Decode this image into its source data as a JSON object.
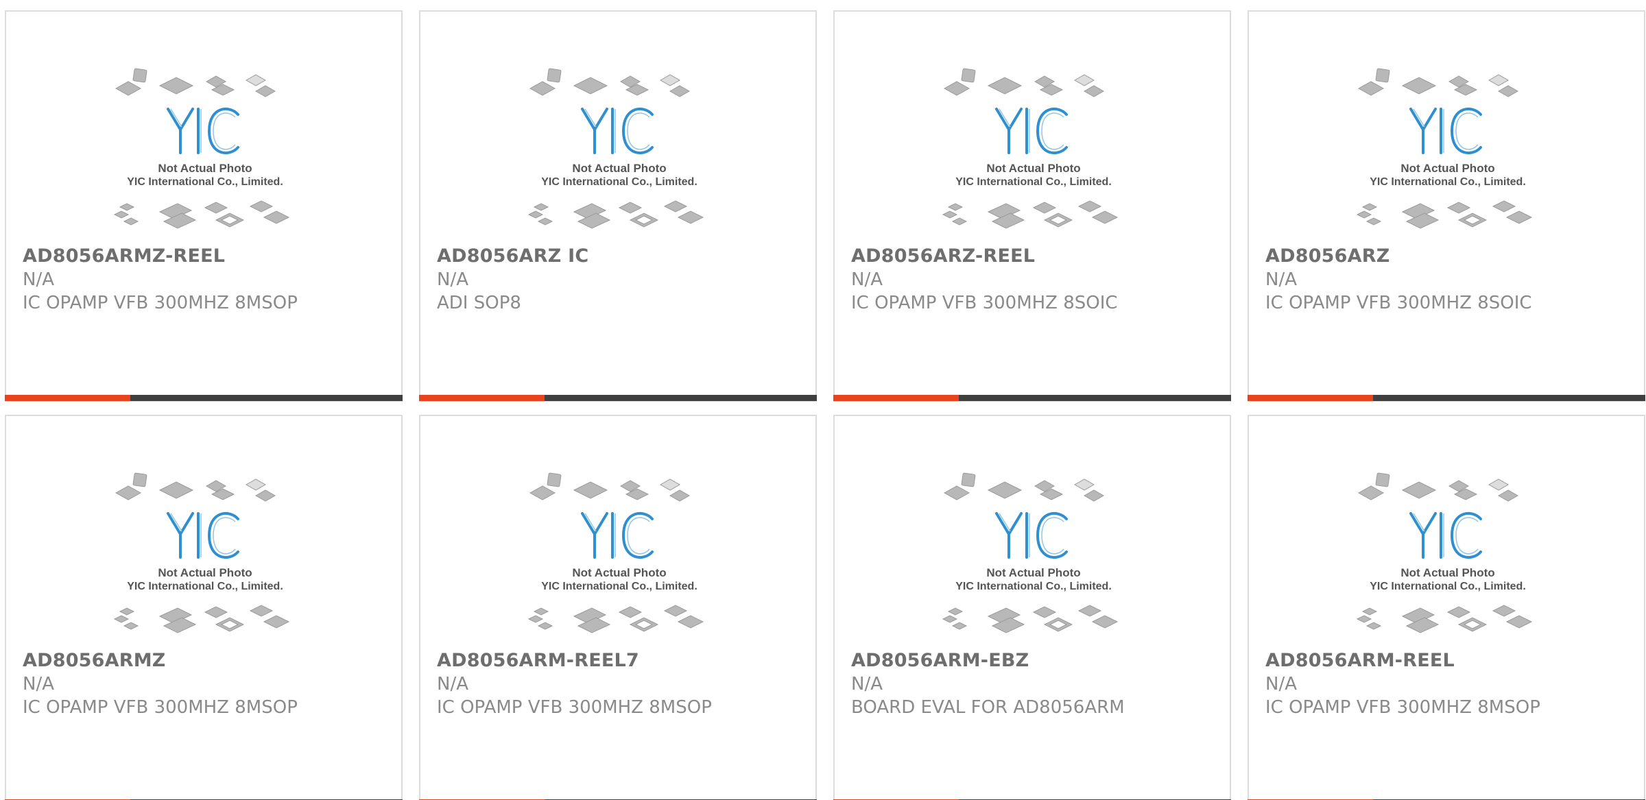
{
  "colors": {
    "accent": "#e8431d",
    "bar": "#3f3f3f",
    "logo": "#2f8fcf"
  },
  "placeholder_image": {
    "line1": "Not Actual Photo",
    "line2": "YIC International Co., Limited.",
    "icon": "yic-placeholder-icon"
  },
  "products": [
    {
      "part": "AD8056ARMZ-REEL",
      "manufacturer": "N/A",
      "description": "IC OPAMP VFB 300MHZ 8MSOP"
    },
    {
      "part": "AD8056ARZ IC",
      "manufacturer": "N/A",
      "description": "ADI SOP8"
    },
    {
      "part": "AD8056ARZ-REEL",
      "manufacturer": "N/A",
      "description": "IC OPAMP VFB 300MHZ 8SOIC"
    },
    {
      "part": "AD8056ARZ",
      "manufacturer": "N/A",
      "description": "IC OPAMP VFB 300MHZ 8SOIC"
    },
    {
      "part": "AD8056ARMZ",
      "manufacturer": "N/A",
      "description": "IC OPAMP VFB 300MHZ 8MSOP"
    },
    {
      "part": "AD8056ARM-REEL7",
      "manufacturer": "N/A",
      "description": "IC OPAMP VFB 300MHZ 8MSOP"
    },
    {
      "part": "AD8056ARM-EBZ",
      "manufacturer": "N/A",
      "description": "BOARD EVAL FOR AD8056ARM"
    },
    {
      "part": "AD8056ARM-REEL",
      "manufacturer": "N/A",
      "description": "IC OPAMP VFB 300MHZ 8MSOP"
    }
  ]
}
